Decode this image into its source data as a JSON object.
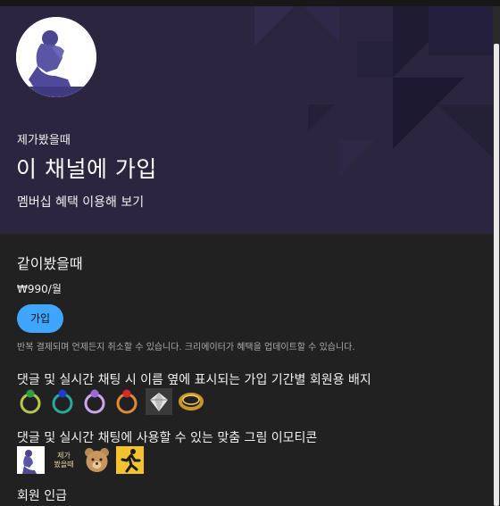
{
  "hero": {
    "channel_name": "제가봤을때",
    "title": "이 채널에 가입",
    "subtitle": "멤버십 혜택 이용해 보기"
  },
  "tier": {
    "name": "같이봤을때",
    "price": "₩990/월",
    "join_label": "가입",
    "notice": "반복 결제되며 언제든지 취소할 수 있습니다. 크리에이터가 혜택을 업데이트할 수 있습니다."
  },
  "perks": {
    "badges_title": "댓글 및 실시간 채팅 시 이름 옆에 표시되는 가입 기간별 회원용 배지",
    "badges": [
      {
        "icon": "green-gem-ring-icon",
        "color": "#2ea043"
      },
      {
        "icon": "blue-gem-ring-icon",
        "color": "#1e3ccf"
      },
      {
        "icon": "purple-gem-ring-icon",
        "color": "#9a6bd8"
      },
      {
        "icon": "red-gem-ring-icon",
        "color": "#d42a2a"
      },
      {
        "icon": "diamond-icon",
        "color": "#cfcfcf"
      },
      {
        "icon": "gold-ring-icon",
        "color": "#c8962a"
      }
    ],
    "emotes_title": "댓글 및 실시간 채팅에 사용할 수 있는 맞춤 그림 이모티콘",
    "emotes": [
      {
        "icon": "thinker-statue-emote"
      },
      {
        "icon": "text-emote",
        "lines": [
          "제가",
          "봤을때"
        ]
      },
      {
        "icon": "bear-face-emote"
      },
      {
        "icon": "running-man-emote"
      }
    ],
    "member_level_title": "회원 인급"
  },
  "colors": {
    "hero_bg": "#2b2540",
    "page_bg": "#212121",
    "accent": "#3ea6ff"
  }
}
